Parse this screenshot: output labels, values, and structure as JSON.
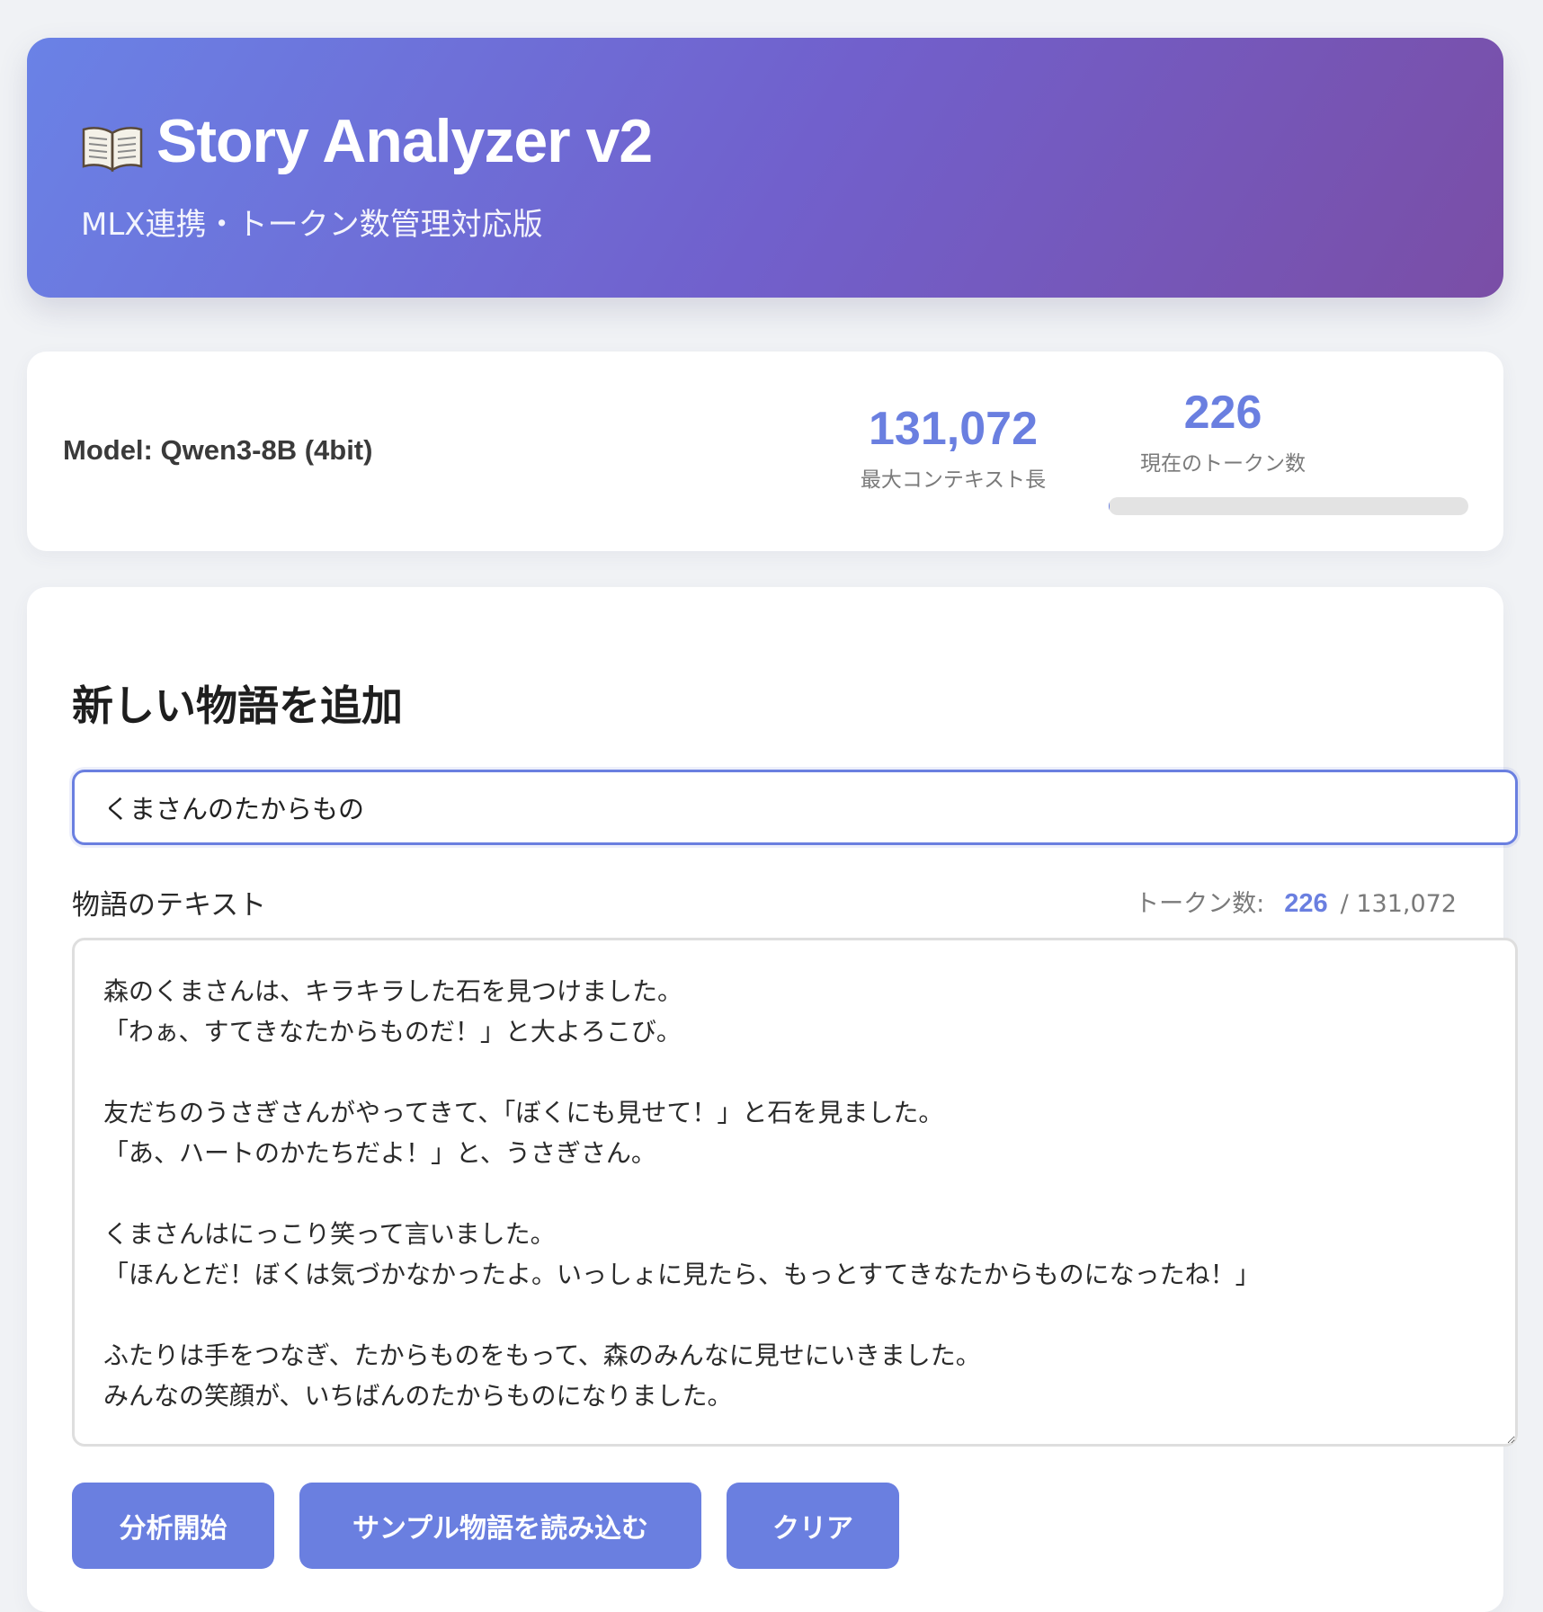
{
  "header": {
    "title": "Story Analyzer v2",
    "subtitle": "MLX連携・トークン数管理対応版",
    "icon": "book-icon"
  },
  "stats": {
    "model_label": "Model: Qwen3-8B (4bit)",
    "max_context_value": "131,072",
    "max_context_caption": "最大コンテキスト長",
    "current_tokens_value": "226",
    "current_tokens_caption": "現在のトークン数",
    "token_usage_fraction": 0.0017
  },
  "form": {
    "heading": "新しい物語を追加",
    "title_value": "くまさんのたからもの",
    "text_label": "物語のテキスト",
    "token_counter_label": "トークン数:",
    "token_counter_value": "226",
    "token_counter_max": "/ 131,072",
    "story_text": "森のくまさんは、キラキラした石を見つけました。\n「わぁ、すてきなたからものだ！」と大よろこび。\n\n友だちのうさぎさんがやってきて、「ぼくにも見せて！」と石を見ました。\n「あ、ハートのかたちだよ！」と、うさぎさん。\n\nくまさんはにっこり笑って言いました。\n「ほんとだ！ぼくは気づかなかったよ。いっしょに見たら、もっとすてきなたからものになったね！」\n\nふたりは手をつなぎ、たからものをもって、森のみんなに見せにいきました。\nみんなの笑顔が、いちばんのたからものになりました。"
  },
  "buttons": {
    "analyze": "分析開始",
    "load_sample": "サンプル物語を読み込む",
    "clear": "クリア"
  },
  "colors": {
    "accent": "#6a7fe0",
    "header_gradient_start": "#6a82e6",
    "header_gradient_end": "#7a4ea6",
    "page_background": "#f0f2f5"
  }
}
